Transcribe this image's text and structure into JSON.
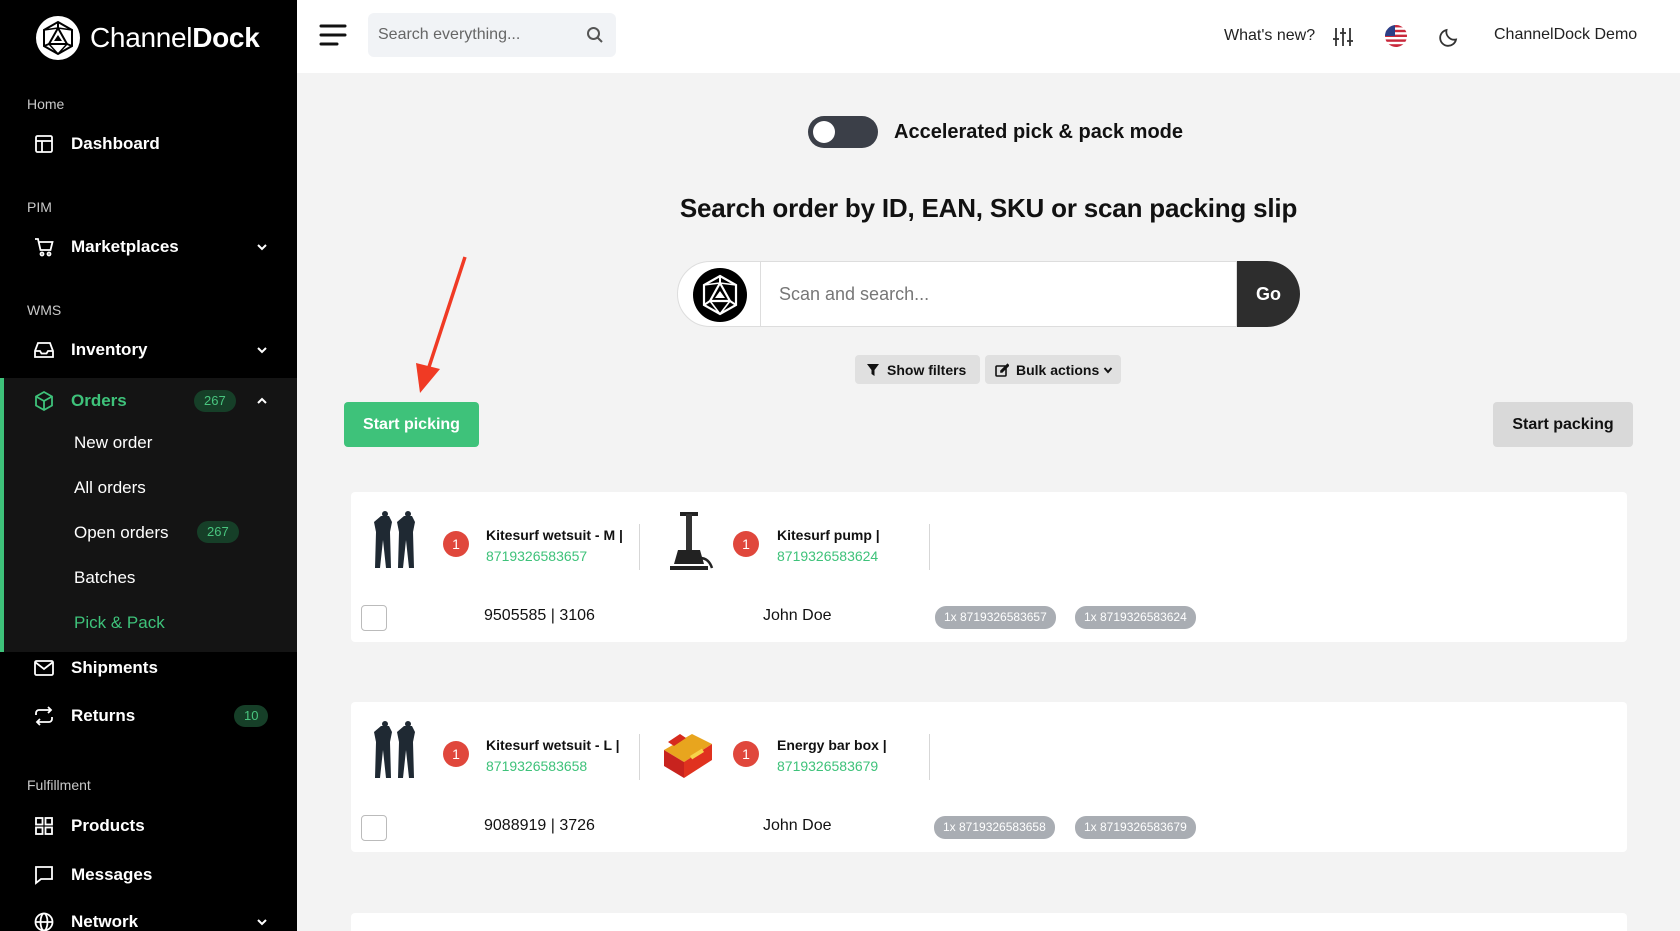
{
  "brand": {
    "name_light": "Channel",
    "name_bold": "Dock"
  },
  "sidebar": {
    "sections": {
      "home": "Home",
      "pim": "PIM",
      "wms": "WMS",
      "fulfillment": "Fulfillment"
    },
    "items": {
      "dashboard": "Dashboard",
      "marketplaces": "Marketplaces",
      "inventory": "Inventory",
      "orders": "Orders",
      "orders_badge": "267",
      "shipments": "Shipments",
      "returns": "Returns",
      "returns_badge": "10",
      "products": "Products",
      "messages": "Messages",
      "network": "Network"
    },
    "orders_sub": {
      "new_order": "New order",
      "all_orders": "All orders",
      "open_orders": "Open orders",
      "open_orders_badge": "267",
      "batches": "Batches",
      "pick_pack": "Pick & Pack"
    }
  },
  "topbar": {
    "search_placeholder": "Search everything...",
    "whats_new": "What's new?",
    "user": "ChannelDock Demo"
  },
  "main": {
    "toggle_label": "Accelerated pick & pack mode",
    "toggle_on": false,
    "headline": "Search order by ID, EAN, SKU or scan packing slip",
    "scan_placeholder": "Scan and search...",
    "go_label": "Go",
    "show_filters": "Show filters",
    "bulk_actions": "Bulk actions",
    "start_picking": "Start picking",
    "start_packing": "Start packing"
  },
  "orders": [
    {
      "products": [
        {
          "qty": "1",
          "name": "Kitesurf wetsuit - M |",
          "ean": "8719326583657",
          "image": "wetsuit-image"
        },
        {
          "qty": "1",
          "name": "Kitesurf pump |",
          "ean": "8719326583624",
          "image": "pump-image"
        }
      ],
      "order_ref": "9505585 | 3106",
      "customer": "John Doe",
      "tags": [
        "1x 8719326583657",
        "1x 8719326583624"
      ]
    },
    {
      "products": [
        {
          "qty": "1",
          "name": "Kitesurf wetsuit - L |",
          "ean": "8719326583658",
          "image": "wetsuit-image"
        },
        {
          "qty": "1",
          "name": "Energy bar box |",
          "ean": "8719326583679",
          "image": "energy-bar-box-image"
        }
      ],
      "order_ref": "9088919 | 3726",
      "customer": "John Doe",
      "tags": [
        "1x 8719326583658",
        "1x 8719326583679"
      ]
    }
  ],
  "colors": {
    "accent": "#3ec27a",
    "sidebar_bg": "#000000",
    "qty_badge": "#e0473c",
    "annotation_arrow": "#f03a24"
  }
}
